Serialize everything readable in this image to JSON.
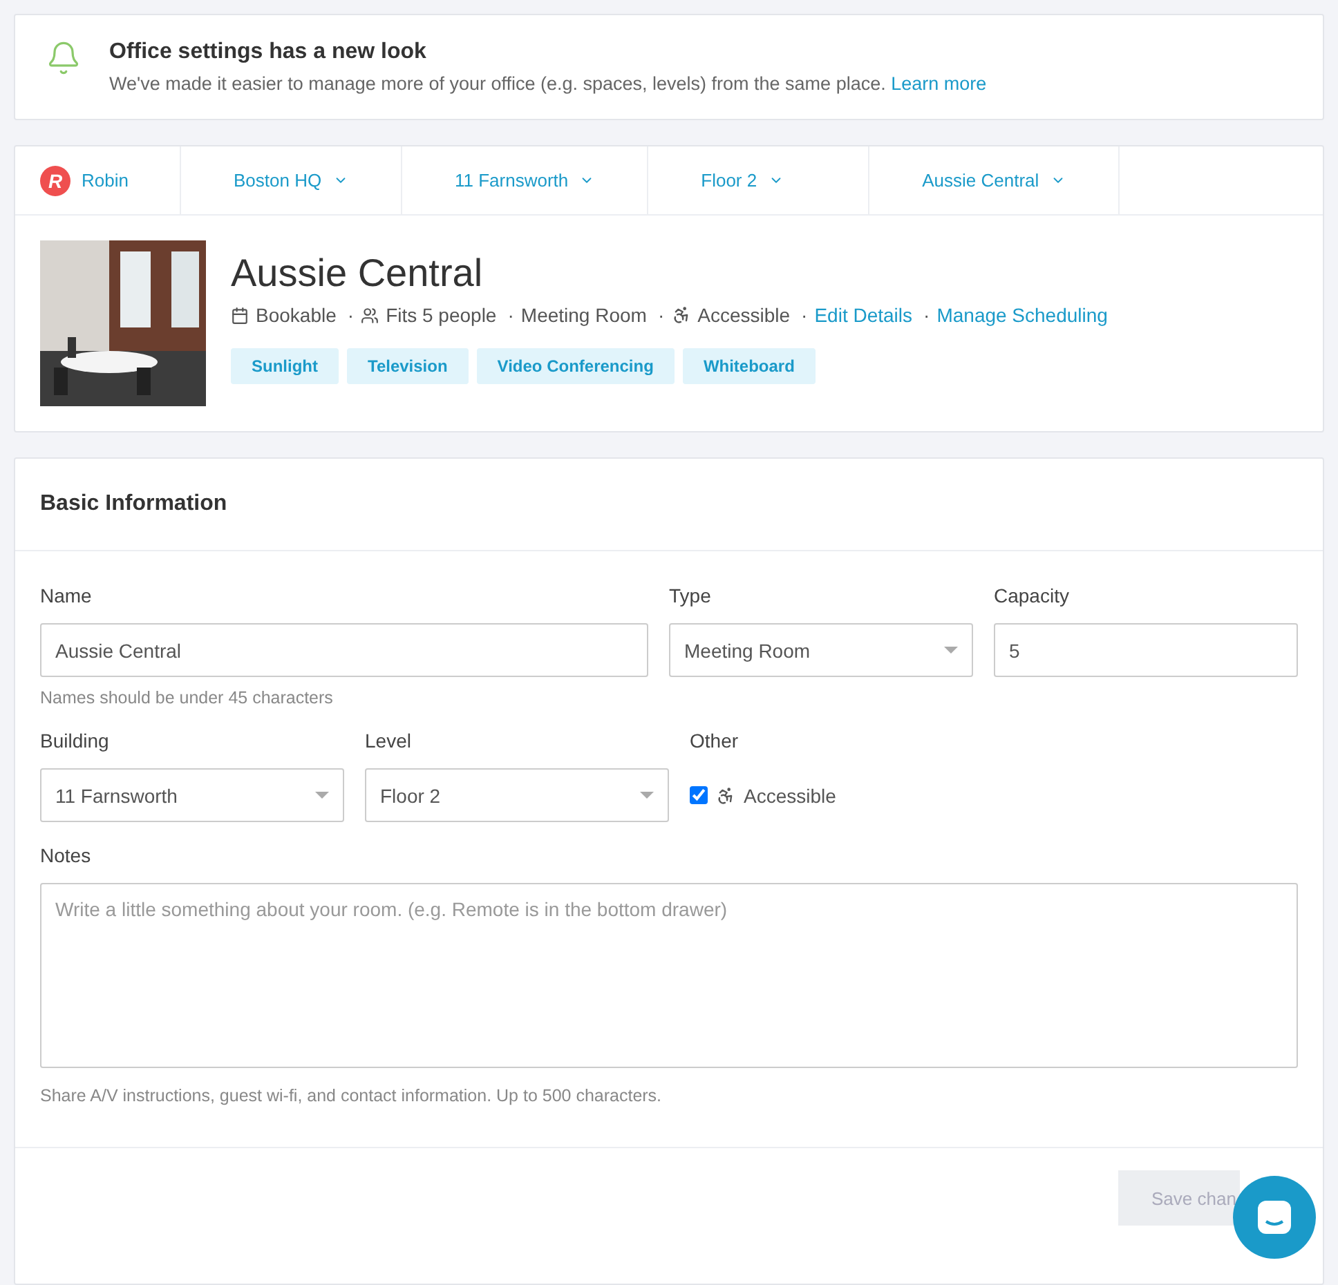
{
  "notice": {
    "title": "Office settings has a new look",
    "text": "We've made it easier to manage more of your office (e.g. spaces, levels) from the same place.",
    "link": "Learn more"
  },
  "breadcrumbs": [
    {
      "label": "Robin",
      "kind": "logo",
      "logo": "R"
    },
    {
      "label": "Boston HQ",
      "kind": "dropdown"
    },
    {
      "label": "11 Farnsworth",
      "kind": "dropdown"
    },
    {
      "label": "Floor 2",
      "kind": "dropdown"
    },
    {
      "label": "Aussie Central",
      "kind": "dropdown"
    }
  ],
  "space": {
    "title": "Aussie Central",
    "meta": [
      {
        "kind": "calendar",
        "text": "Bookable"
      },
      {
        "kind": "people",
        "sep": "·",
        "text": "Fits 5 people"
      },
      {
        "kind": "plain",
        "sep": "·",
        "text": "Meeting Room"
      },
      {
        "kind": "accessible",
        "sep": "·",
        "text": "Accessible"
      },
      {
        "kind": "link",
        "sep": "·",
        "text": "Edit Details"
      },
      {
        "kind": "link",
        "sep": "·",
        "text": "Manage Scheduling"
      }
    ],
    "tags": [
      "Sunlight",
      "Television",
      "Video Conferencing",
      "Whiteboard"
    ]
  },
  "form": {
    "title": "Basic Information",
    "name": {
      "label": "Name",
      "value": "Aussie Central",
      "help": "Names should be under 45 characters"
    },
    "type": {
      "label": "Type",
      "value": "Meeting Room"
    },
    "capacity": {
      "label": "Capacity",
      "value": "5"
    },
    "building": {
      "label": "Building",
      "value": "11 Farnsworth"
    },
    "level": {
      "label": "Level",
      "value": "Floor 2"
    },
    "other": {
      "label": "Other",
      "option": "Accessible",
      "checked": true
    },
    "notes": {
      "label": "Notes",
      "placeholder": "Write a little something about your room. (e.g. Remote is in the bottom drawer)",
      "help": "Share A/V instructions, guest wi-fi, and contact information. Up to 500 characters."
    },
    "save": {
      "label": "Save chan",
      "disabled": true
    }
  }
}
